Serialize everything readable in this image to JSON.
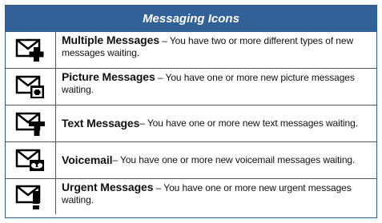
{
  "table": {
    "title": "Messaging Icons",
    "rows": [
      {
        "icon": "envelope-plus-icon",
        "title": "Multiple Messages",
        "desc": " – You have two or more different types of new messages waiting."
      },
      {
        "icon": "envelope-picture-icon",
        "title": "Picture Messages",
        "desc": " – You have one or more new picture messages waiting."
      },
      {
        "icon": "envelope-text-icon",
        "title": "Text Messages",
        "desc": " – You have one or more new text messages waiting."
      },
      {
        "icon": "envelope-voicemail-icon",
        "title": "Voicemail",
        "desc": " – You have one or more new voicemail messages waiting."
      },
      {
        "icon": "envelope-urgent-icon",
        "title": "Urgent Messages",
        "desc": " – You have one or more new urgent messages waiting."
      }
    ]
  }
}
